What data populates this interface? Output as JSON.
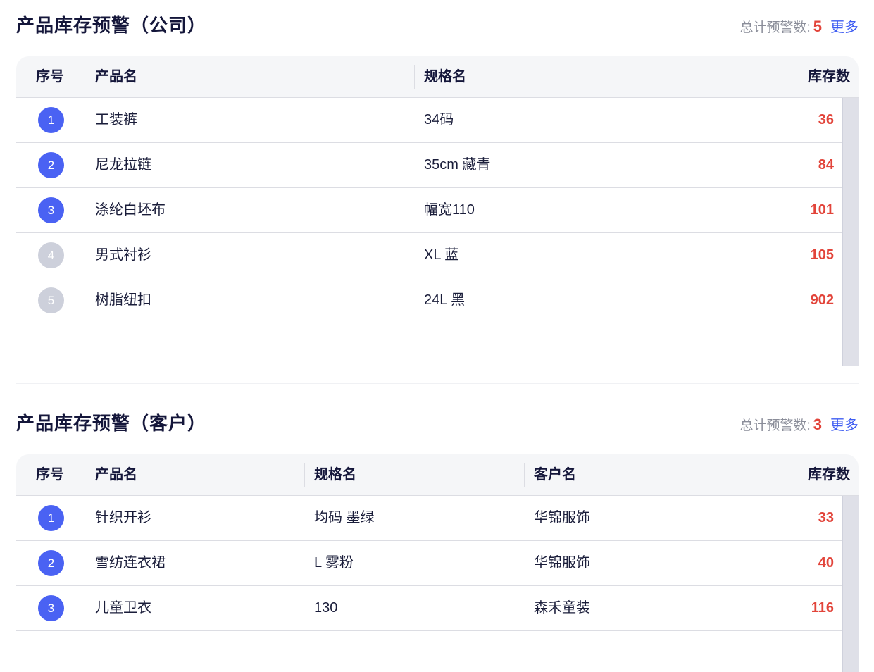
{
  "company_section": {
    "title": "产品库存预警（公司）",
    "summary_label": "总计预警数:",
    "summary_count": "5",
    "more_label": "更多",
    "columns": [
      "序号",
      "产品名",
      "规格名",
      "库存数"
    ],
    "rows": [
      {
        "index": "1",
        "product": "工装裤",
        "spec": "34码",
        "stock": "36"
      },
      {
        "index": "2",
        "product": "尼龙拉链",
        "spec": "35cm 藏青",
        "stock": "84"
      },
      {
        "index": "3",
        "product": "涤纶白坯布",
        "spec": "幅宽110",
        "stock": "101"
      },
      {
        "index": "4",
        "product": "男式衬衫",
        "spec": "XL 蓝",
        "stock": "105"
      },
      {
        "index": "5",
        "product": "树脂纽扣",
        "spec": "24L 黑",
        "stock": "902"
      }
    ]
  },
  "customer_section": {
    "title": "产品库存预警（客户）",
    "summary_label": "总计预警数:",
    "summary_count": "3",
    "more_label": "更多",
    "columns": [
      "序号",
      "产品名",
      "规格名",
      "客户名",
      "库存数"
    ],
    "rows": [
      {
        "index": "1",
        "product": "针织开衫",
        "spec": "均码 墨绿",
        "customer": "华锦服饰",
        "stock": "33"
      },
      {
        "index": "2",
        "product": "雪纺连衣裙",
        "spec": "L 雾粉",
        "customer": "华锦服饰",
        "stock": "40"
      },
      {
        "index": "3",
        "product": "儿童卫衣",
        "spec": "130",
        "customer": "森禾童装",
        "stock": "116"
      }
    ]
  },
  "colors": {
    "accent": "#4a62f3",
    "alert": "#e2443a",
    "badge_inactive": "#cdd0db"
  }
}
